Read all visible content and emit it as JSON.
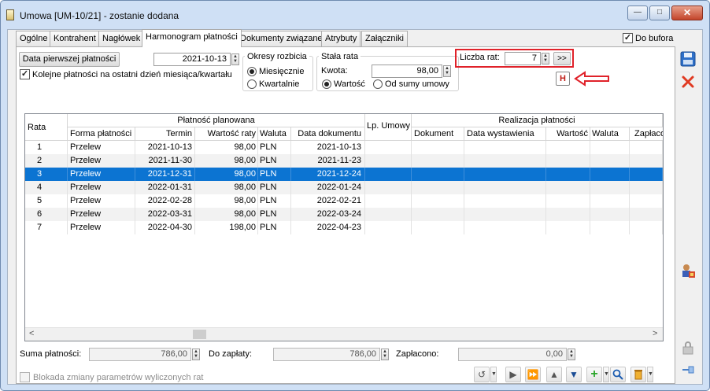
{
  "window": {
    "title": "Umowa [UM-10/21] - zostanie dodana"
  },
  "tabs": [
    "Ogólne",
    "Kontrahent",
    "Nagłówek",
    "Harmonogram płatności",
    "Dokumenty związane",
    "Atrybuty",
    "Załączniki"
  ],
  "do_bufora_label": "Do bufora",
  "first_payment": {
    "button_label": "Data pierwszej płatności",
    "date": "2021-10-13"
  },
  "last_day_checkbox_label": "Kolejne płatności na ostatni dzień miesiąca/kwartału",
  "periods": {
    "title": "Okresy rozbicia",
    "monthly": "Miesięcznie",
    "quarterly": "Kwartalnie",
    "selected": "monthly"
  },
  "fixed_rate": {
    "title": "Stała rata",
    "amount_label": "Kwota:",
    "amount_value": "98,00",
    "value_option": "Wartość",
    "contract_sum_option": "Od sumy umowy"
  },
  "installments": {
    "label": "Liczba rat:",
    "value": "7",
    "next_button": ">>",
    "h_button": "H"
  },
  "grid": {
    "col_rata": "Rata",
    "group_planned": "Płatność planowana",
    "col_lp_umowy": "Lp. Umowy",
    "group_realization": "Realizacja płatności",
    "planned_columns": [
      "Forma płatności",
      "Termin",
      "Wartość raty",
      "Waluta",
      "Data dokumentu"
    ],
    "realization_columns": [
      "Dokument",
      "Data wystawienia",
      "Wartość",
      "Waluta",
      "Zapłacono"
    ],
    "rows": [
      {
        "rata": "1",
        "forma": "Przelew",
        "termin": "2021-10-13",
        "wartosc": "98,00",
        "waluta": "PLN",
        "data_dok": "2021-10-13"
      },
      {
        "rata": "2",
        "forma": "Przelew",
        "termin": "2021-11-30",
        "wartosc": "98,00",
        "waluta": "PLN",
        "data_dok": "2021-11-23"
      },
      {
        "rata": "3",
        "forma": "Przelew",
        "termin": "2021-12-31",
        "wartosc": "98,00",
        "waluta": "PLN",
        "data_dok": "2021-12-24"
      },
      {
        "rata": "4",
        "forma": "Przelew",
        "termin": "2022-01-31",
        "wartosc": "98,00",
        "waluta": "PLN",
        "data_dok": "2022-01-24"
      },
      {
        "rata": "5",
        "forma": "Przelew",
        "termin": "2022-02-28",
        "wartosc": "98,00",
        "waluta": "PLN",
        "data_dok": "2022-02-21"
      },
      {
        "rata": "6",
        "forma": "Przelew",
        "termin": "2022-03-31",
        "wartosc": "98,00",
        "waluta": "PLN",
        "data_dok": "2022-03-24"
      },
      {
        "rata": "7",
        "forma": "Przelew",
        "termin": "2022-04-30",
        "wartosc": "198,00",
        "waluta": "PLN",
        "data_dok": "2022-04-23"
      }
    ],
    "selected_row": 2,
    "scroll_left": "<",
    "scroll_right": ">"
  },
  "totals": {
    "suma_label": "Suma płatności:",
    "suma_value": "786,00",
    "do_zaplaty_label": "Do zapłaty:",
    "do_zaplaty_value": "786,00",
    "zaplacono_label": "Zapłacono:",
    "zaplacono_value": "0,00"
  },
  "blokada_label": "Blokada zmiany parametrów wyliczonych rat",
  "colors": {
    "selected_row": "#0c74d2",
    "highlight": "#e0222a",
    "window_frame": "#cfe0f5"
  }
}
